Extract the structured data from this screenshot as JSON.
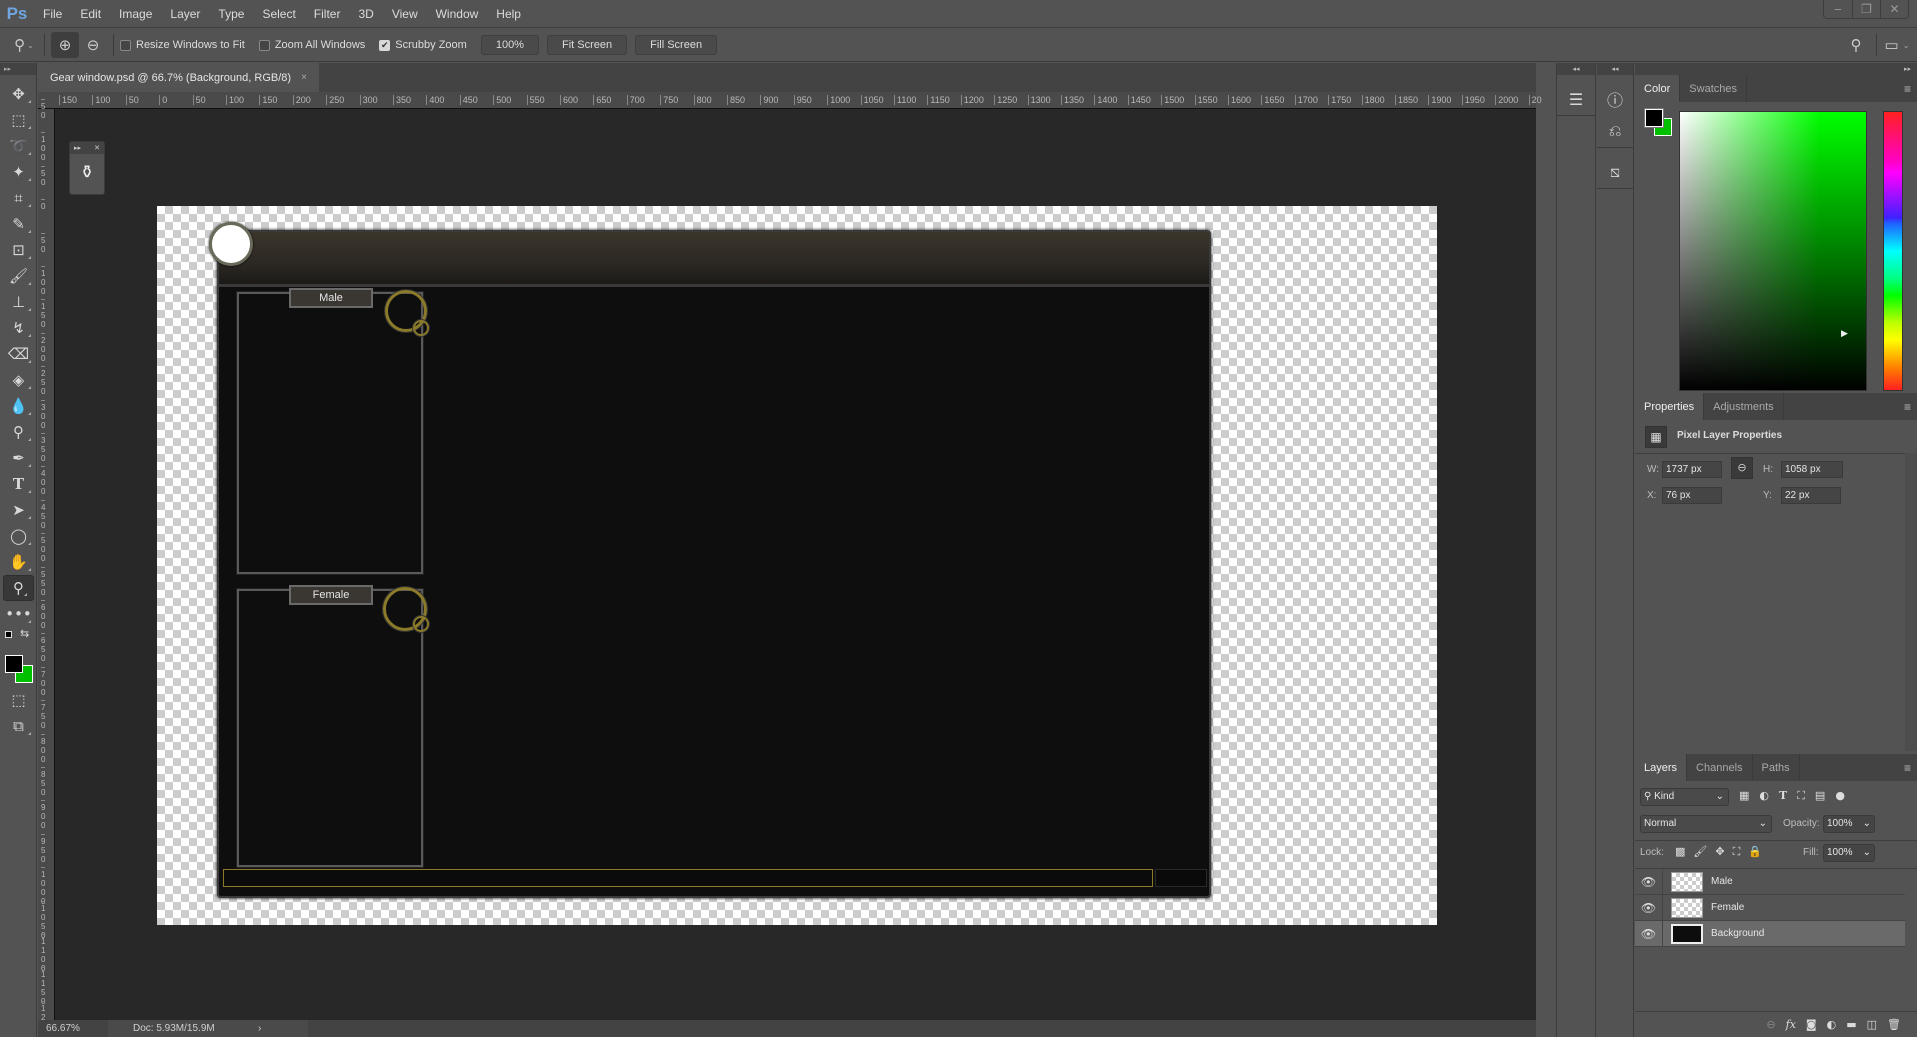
{
  "app": {
    "logo": "Ps"
  },
  "menu": [
    "File",
    "Edit",
    "Image",
    "Layer",
    "Type",
    "Select",
    "Filter",
    "3D",
    "View",
    "Window",
    "Help"
  ],
  "window_controls": {
    "minimize": "‒",
    "restore": "❐",
    "close": "✕"
  },
  "options_bar": {
    "tool_icon": "zoom-icon",
    "resize_windows": {
      "label": "Resize Windows to Fit",
      "checked": false
    },
    "zoom_all": {
      "label": "Zoom All Windows",
      "checked": false
    },
    "scrubby": {
      "label": "Scrubby Zoom",
      "checked": true
    },
    "btn_100": "100%",
    "btn_fit": "Fit Screen",
    "btn_fill": "Fill Screen"
  },
  "document": {
    "tab_title": "Gear window.psd @ 66.7% (Background, RGB/8)",
    "close": "×",
    "male_label": "Male",
    "female_label": "Female"
  },
  "rulers": {
    "h": [
      "150",
      "100",
      "50",
      "0",
      "50",
      "100",
      "150",
      "200",
      "250",
      "300",
      "350",
      "400",
      "450",
      "500",
      "550",
      "600",
      "650",
      "700",
      "750",
      "800",
      "850",
      "900",
      "950",
      "1000",
      "1050",
      "1100",
      "1150",
      "1200",
      "1250",
      "1300",
      "1350",
      "1400",
      "1450",
      "1500",
      "1550",
      "1600",
      "1650",
      "1700",
      "1750",
      "1800",
      "1850",
      "1900",
      "1950",
      "2000",
      "20"
    ],
    "v": [
      "50",
      "100",
      "50",
      "0",
      "50",
      "100",
      "150",
      "200",
      "250",
      "300",
      "350",
      "400",
      "450",
      "500",
      "550",
      "600",
      "650",
      "700",
      "750",
      "800",
      "850",
      "900",
      "950",
      "1000",
      "1050",
      "1100",
      "1150",
      "12"
    ]
  },
  "status": {
    "zoom": "66.67%",
    "doc": "Doc: 5.93M/15.9M",
    "arrow": "›"
  },
  "color_panel": {
    "tabs": [
      "Color",
      "Swatches"
    ],
    "foreground": "#000000",
    "background": "#00c000",
    "hue_color": "#00ff00"
  },
  "properties": {
    "tabs": [
      "Properties",
      "Adjustments"
    ],
    "title": "Pixel Layer Properties",
    "w_label": "W:",
    "w": "1737 px",
    "h_label": "H:",
    "h": "1058 px",
    "x_label": "X:",
    "x": "76 px",
    "y_label": "Y:",
    "y": "22 px"
  },
  "layers_panel": {
    "tabs": [
      "Layers",
      "Channels",
      "Paths"
    ],
    "filter_kind": "Kind",
    "blend_mode": "Normal",
    "opacity_label": "Opacity:",
    "opacity": "100%",
    "lock_label": "Lock:",
    "fill_label": "Fill:",
    "fill": "100%",
    "layers": [
      {
        "name": "Male",
        "visible": true,
        "selected": false
      },
      {
        "name": "Female",
        "visible": true,
        "selected": false
      },
      {
        "name": "Background",
        "visible": true,
        "selected": true
      }
    ]
  }
}
